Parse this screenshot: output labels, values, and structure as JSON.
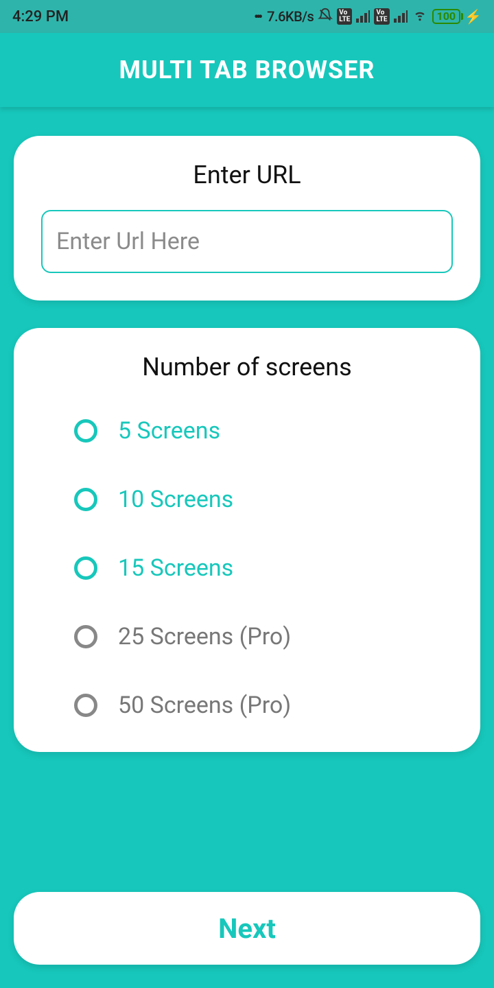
{
  "status": {
    "time": "4:29 PM",
    "speed": "7.6KB/s",
    "battery": "100"
  },
  "header": {
    "title": "MULTI TAB BROWSER"
  },
  "url_card": {
    "title": "Enter URL",
    "placeholder": "Enter Url Here",
    "value": ""
  },
  "screens_card": {
    "title": "Number of screens",
    "options": [
      {
        "label": "5 Screens",
        "pro": false
      },
      {
        "label": "10 Screens",
        "pro": false
      },
      {
        "label": "15 Screens",
        "pro": false
      },
      {
        "label": "25 Screens (Pro)",
        "pro": true
      },
      {
        "label": "50 Screens (Pro)",
        "pro": true
      }
    ]
  },
  "next_label": "Next"
}
